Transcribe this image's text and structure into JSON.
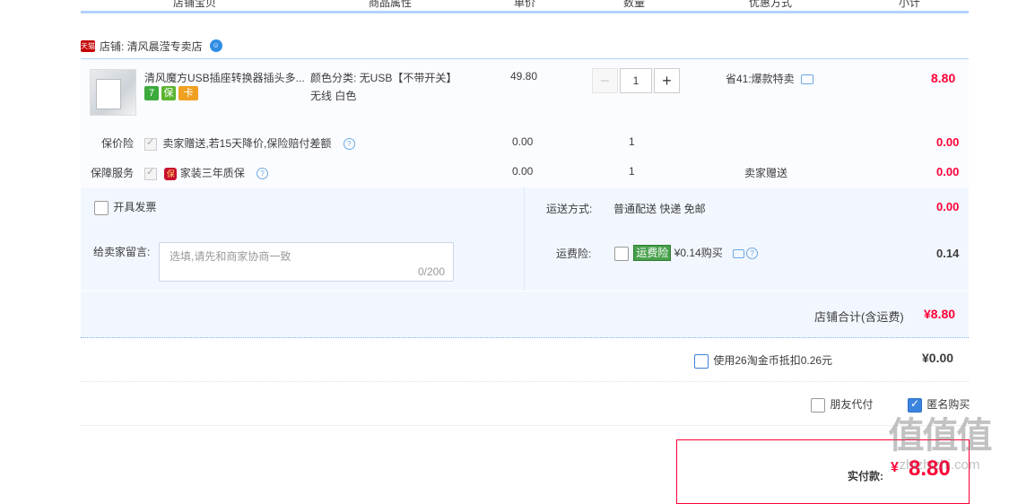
{
  "header": {
    "columns": [
      "店铺宝贝",
      "商品属性",
      "单价",
      "数量",
      "优惠方式",
      "小计"
    ]
  },
  "shop": {
    "platform_badge": "天猫",
    "label": "店铺: 清风晨滢专卖店"
  },
  "product": {
    "title": "清风魔方USB插座转换器插头多...",
    "badges": [
      "7",
      "保",
      "卡"
    ],
    "attr_line1": "颜色分类: 无USB【不带开关】",
    "attr_line2": "无线 白色",
    "unit_price": "49.80",
    "qty_minus": "−",
    "qty": "1",
    "qty_plus": "+",
    "discount": "省41:爆款特卖",
    "subtotal": "8.80"
  },
  "insurance": {
    "label": "保价险",
    "desc": "卖家赠送,若15天降价,保险赔付差额",
    "price": "0.00",
    "qty": "1",
    "subtotal": "0.00"
  },
  "service": {
    "label": "保障服务",
    "icon_text": "保",
    "desc": "家装三年质保",
    "price": "0.00",
    "qty": "1",
    "discount": "卖家赠送",
    "subtotal": "0.00"
  },
  "invoice": {
    "label": "开具发票"
  },
  "shipping": {
    "label": "运送方式:",
    "value": "普通配送 快递 免邮",
    "price": "0.00"
  },
  "memo": {
    "label": "给卖家留言:",
    "placeholder": "选填,请先和商家协商一致",
    "counter": "0/200"
  },
  "freight_insurance": {
    "label": "运费险:",
    "tag": "运费险",
    "desc": "¥0.14购买",
    "price": "0.14"
  },
  "shop_total": {
    "label": "店铺合计(含运费)",
    "value": "¥8.80"
  },
  "coins": {
    "label": "使用26淘金币抵扣0.26元",
    "value": "¥0.00"
  },
  "options": {
    "friend_pay": "朋友代付",
    "anonymous": "匿名购买"
  },
  "payment": {
    "label": "实付款:",
    "currency": "¥",
    "amount": "8.80"
  },
  "watermark": {
    "logo": "值值值",
    "site": "zhizhizhi.com"
  },
  "colors": {
    "accent_blue": "#b2d1ff",
    "price_red": "#ff0036",
    "panel_bg": "#f2f7ff"
  }
}
